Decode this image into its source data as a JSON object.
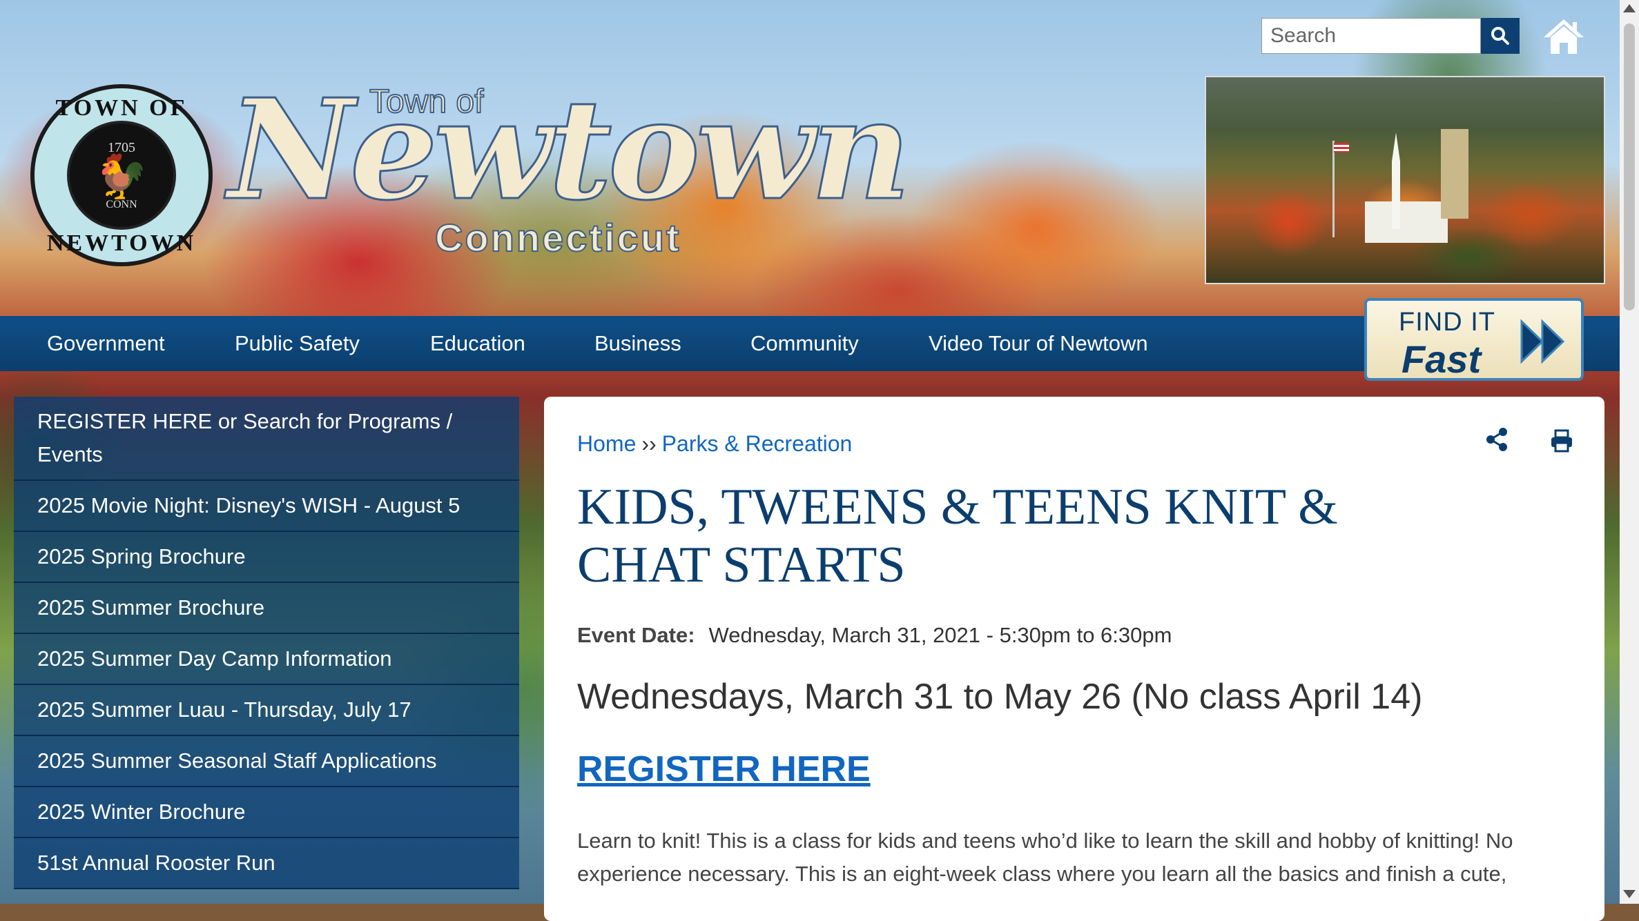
{
  "header": {
    "seal": {
      "top_text": "TOWN OF",
      "bottom_text": "NEWTOWN",
      "year": "1705",
      "state": "CONN"
    },
    "logo": {
      "town_of": "Town of",
      "name": "Newtown",
      "state": "Connecticut"
    },
    "search": {
      "placeholder": "Search"
    }
  },
  "nav": {
    "items": [
      {
        "label": "Government"
      },
      {
        "label": "Public Safety"
      },
      {
        "label": "Education"
      },
      {
        "label": "Business"
      },
      {
        "label": "Community"
      },
      {
        "label": "Video Tour of Newtown"
      }
    ],
    "find_it": {
      "top": "FIND IT",
      "bottom": "Fast"
    }
  },
  "sidebar": {
    "items": [
      {
        "label": "REGISTER HERE or Search for Programs / Events"
      },
      {
        "label": "2025 Movie Night: Disney's WISH - August 5"
      },
      {
        "label": "2025 Spring Brochure"
      },
      {
        "label": "2025 Summer Brochure"
      },
      {
        "label": "2025 Summer Day Camp Information"
      },
      {
        "label": "2025 Summer Luau - Thursday, July 17"
      },
      {
        "label": "2025 Summer Seasonal Staff Applications"
      },
      {
        "label": "2025 Winter Brochure"
      },
      {
        "label": "51st Annual Rooster Run"
      }
    ]
  },
  "content": {
    "breadcrumb": {
      "home": "Home",
      "sep": "››",
      "section": "Parks & Recreation"
    },
    "title": "KIDS, TWEENS & TEENS KNIT & CHAT STARTS",
    "event_date_label": "Event Date:",
    "event_date_value": "Wednesday, March 31, 2021 - 5:30pm to 6:30pm",
    "subtitle": "Wednesdays, March 31 to May 26 (No class April 14)",
    "register_link": "REGISTER HERE",
    "body": "Learn to knit! This is a class for kids and teens who’d like to learn the skill and hobby of knitting! No experience necessary. This is an eight-week class where you learn all the basics and finish a cute,"
  },
  "colors": {
    "nav_blue": "#0b3e6e",
    "link_blue": "#1166c0",
    "title_blue": "#0b3e6e"
  }
}
